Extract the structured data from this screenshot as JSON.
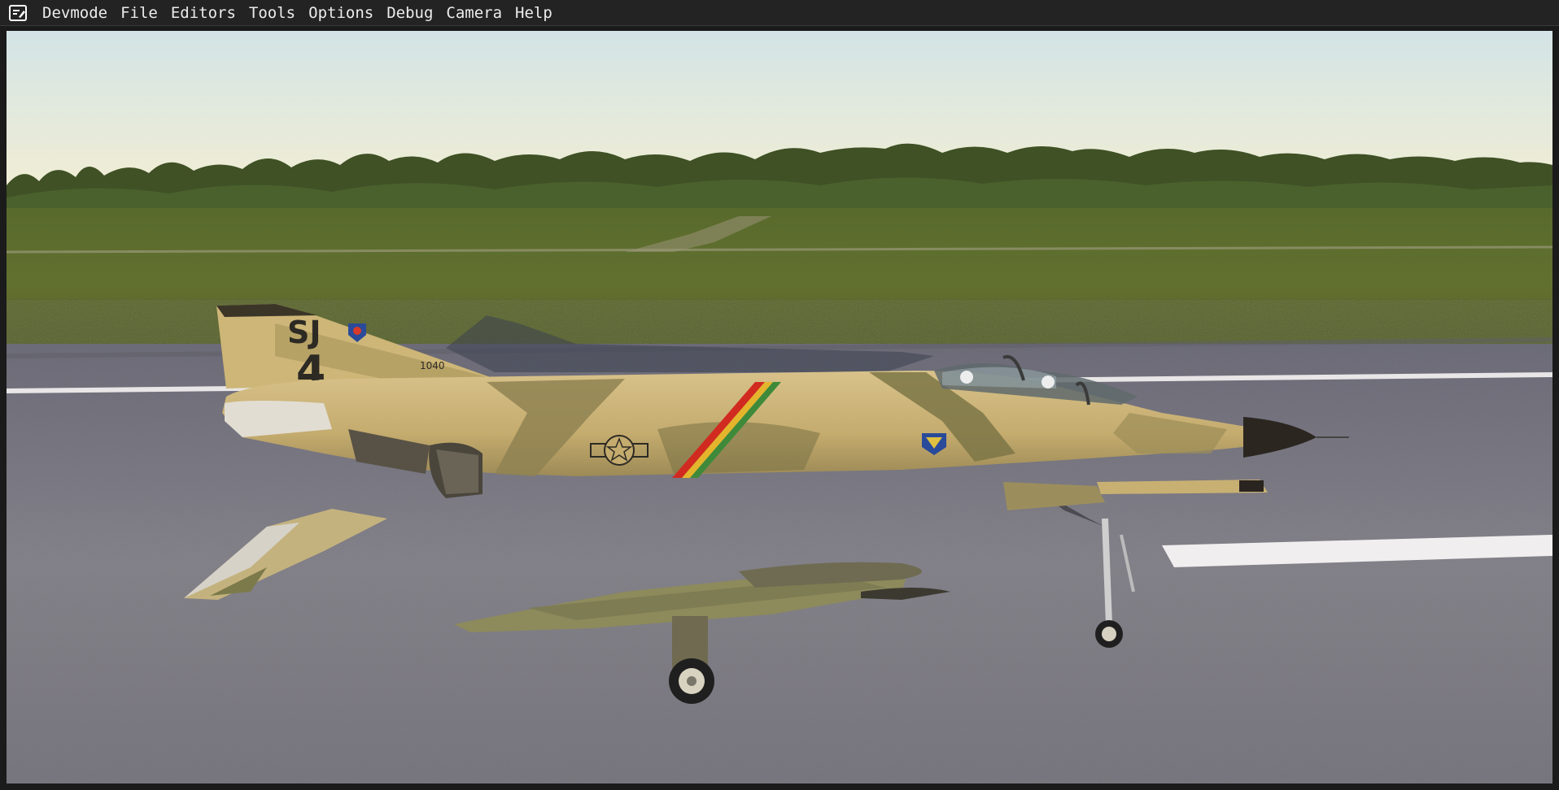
{
  "menubar": {
    "icon": "devmode-icon",
    "items": [
      "Devmode",
      "File",
      "Editors",
      "Tools",
      "Options",
      "Debug",
      "Camera",
      "Help"
    ]
  },
  "scene": {
    "tail_code": "SJ",
    "tail_number": "4",
    "serial": "1040",
    "colors": {
      "menubar_bg": "#232323",
      "sky_top": "#d7e6e6",
      "sky_bottom": "#f3eed3",
      "grass": "#5d6a2e",
      "runway": "#807e88",
      "camo_tan": "#c8b073",
      "camo_dark": "#8e8254",
      "camo_green": "#7c7a4a"
    }
  }
}
